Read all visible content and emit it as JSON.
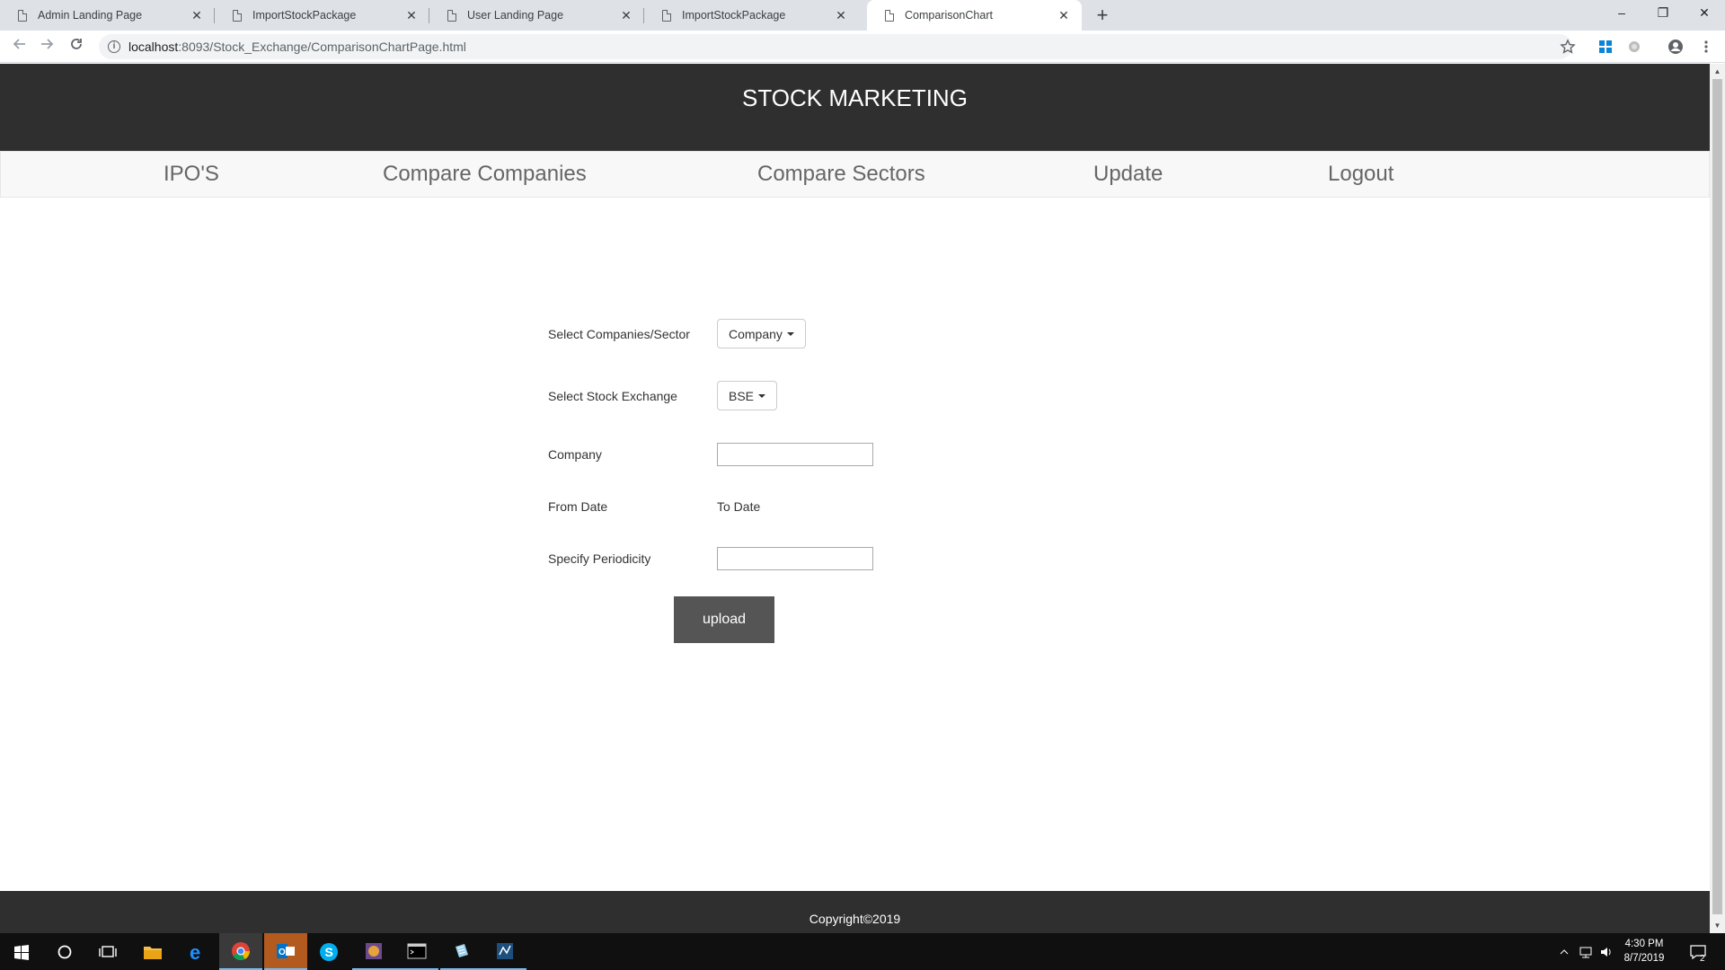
{
  "browser": {
    "tabs": [
      {
        "title": "Admin Landing Page",
        "active": false
      },
      {
        "title": "ImportStockPackage",
        "active": false
      },
      {
        "title": "User Landing Page",
        "active": false
      },
      {
        "title": "ImportStockPackage",
        "active": false
      },
      {
        "title": "ComparisonChart",
        "active": true
      }
    ],
    "new_tab_symbol": "+",
    "close_symbol": "✕",
    "url_host": "localhost",
    "url_rest": ":8093/Stock_Exchange/ComparisonChartPage.html",
    "window_controls": {
      "minimize": "–",
      "restore": "❐",
      "close": "✕"
    }
  },
  "header": {
    "title": "STOCK MARKETING"
  },
  "nav": {
    "items": [
      "IPO'S",
      "Compare Companies",
      "Compare Sectors",
      "Update",
      "Logout"
    ]
  },
  "form": {
    "select_label": "Select Companies/Sector",
    "select_value": "Company",
    "exchange_label": "Select Stock Exchange",
    "exchange_value": "BSE",
    "company_label": "Company",
    "company_value": "",
    "from_date_label": "From Date",
    "to_date_label": "To Date",
    "periodicity_label": "Specify Periodicity",
    "periodicity_value": "",
    "upload_label": "upload"
  },
  "footer": {
    "copyright": "Copyright©2019"
  },
  "taskbar": {
    "time": "4:30 PM",
    "date": "8/7/2019",
    "notification_count": "2"
  },
  "colors": {
    "header_bg": "#2f2f2f",
    "button_bg": "#555555",
    "navbar_bg": "#f8f8f8",
    "tab_strip": "#dee1e6"
  }
}
